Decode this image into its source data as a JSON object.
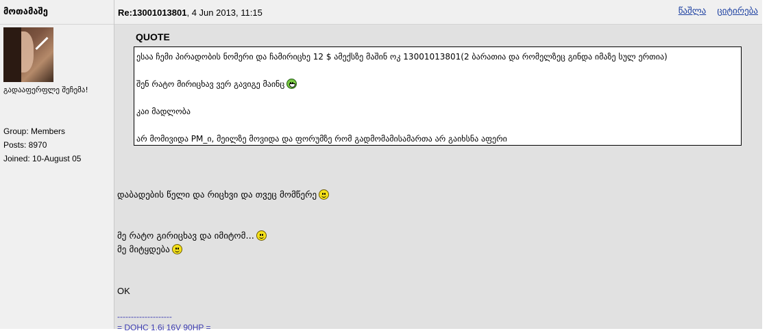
{
  "post": {
    "author": "მოთამაშე",
    "title_prefix": "Re:13001013801",
    "title_date": ", 4 Jun 2013, 11:15",
    "actions": {
      "delete": "წაშლა",
      "quote": "ციტირება"
    }
  },
  "author_panel": {
    "avatar_icon": "avatar-image",
    "member_title": "გადააფერფლე შეჩემა!",
    "group": "Group: Members",
    "posts": "Posts: 8970",
    "joined": "Joined: 10-August 05"
  },
  "quote": {
    "label": "QUOTE",
    "lines": [
      "ესაა ჩემი პირადობის ნომერი და ჩამირიცხე 12 $ ამექსზე მაშინ ოკ 13001013801(2 ბარათია და რომელზეც გინდა იმაზე სულ ერთია)",
      "შენ რატო მირიცხავ ვერ გავიგე მაინც",
      "კაი მადლობა",
      "არ მომივიდა PM_ი, მეილზე მოვიდა და ფორუმზე რომ გადმომამისამართა არ გაიხსნა აფერი"
    ]
  },
  "body": {
    "line1": "დაბადების წელი და რიცხვი და თვეც მომწერე",
    "line2": "მე რატო გირიცხავ და იმიტომ...",
    "line3": "მე მიტყდება",
    "line4": "OK"
  },
  "signature": {
    "rule": "--------------------",
    "line1": "= DOHC 1.6i 16V 90HP ="
  },
  "colors": {
    "link": "#1a3ea0",
    "signature": "#3b3bb0",
    "post_bg": "#e1e1e1",
    "side_bg": "#f0f0f0"
  }
}
